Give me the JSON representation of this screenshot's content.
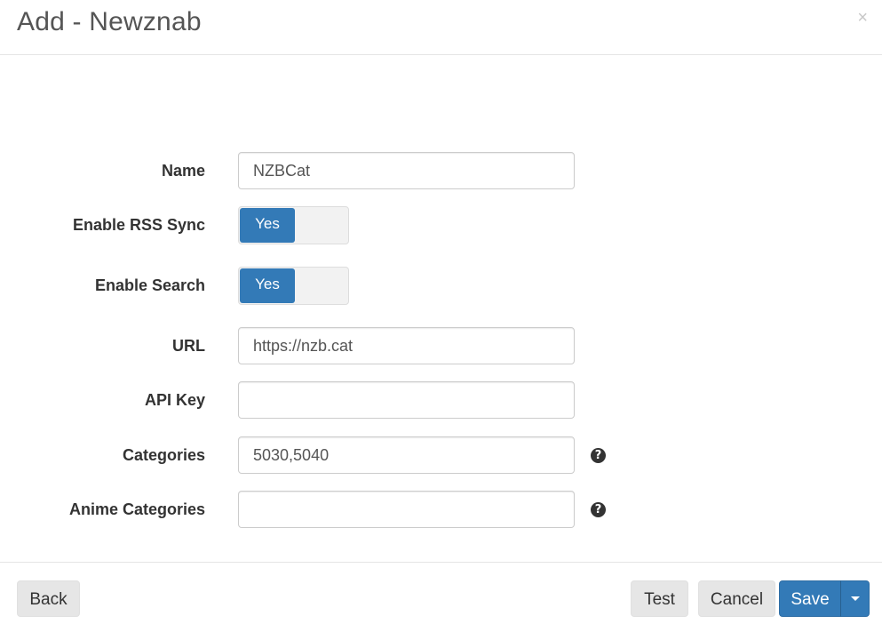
{
  "header": {
    "title": "Add - Newznab",
    "close_symbol": "×"
  },
  "form": {
    "name": {
      "label": "Name",
      "value": "NZBCat"
    },
    "enable_rss": {
      "label": "Enable RSS Sync",
      "state": "Yes"
    },
    "enable_search": {
      "label": "Enable Search",
      "state": "Yes"
    },
    "url": {
      "label": "URL",
      "value": "https://nzb.cat"
    },
    "api_key": {
      "label": "API Key",
      "value": ""
    },
    "categories": {
      "label": "Categories",
      "value": "5030,5040",
      "help_icon": "question-circle-icon"
    },
    "anime_categories": {
      "label": "Anime Categories",
      "value": "",
      "help_icon": "question-circle-icon"
    }
  },
  "footer": {
    "back_label": "Back",
    "test_label": "Test",
    "cancel_label": "Cancel",
    "save_label": "Save"
  },
  "colors": {
    "primary": "#337ab7",
    "default_button": "#e6e6e6"
  }
}
